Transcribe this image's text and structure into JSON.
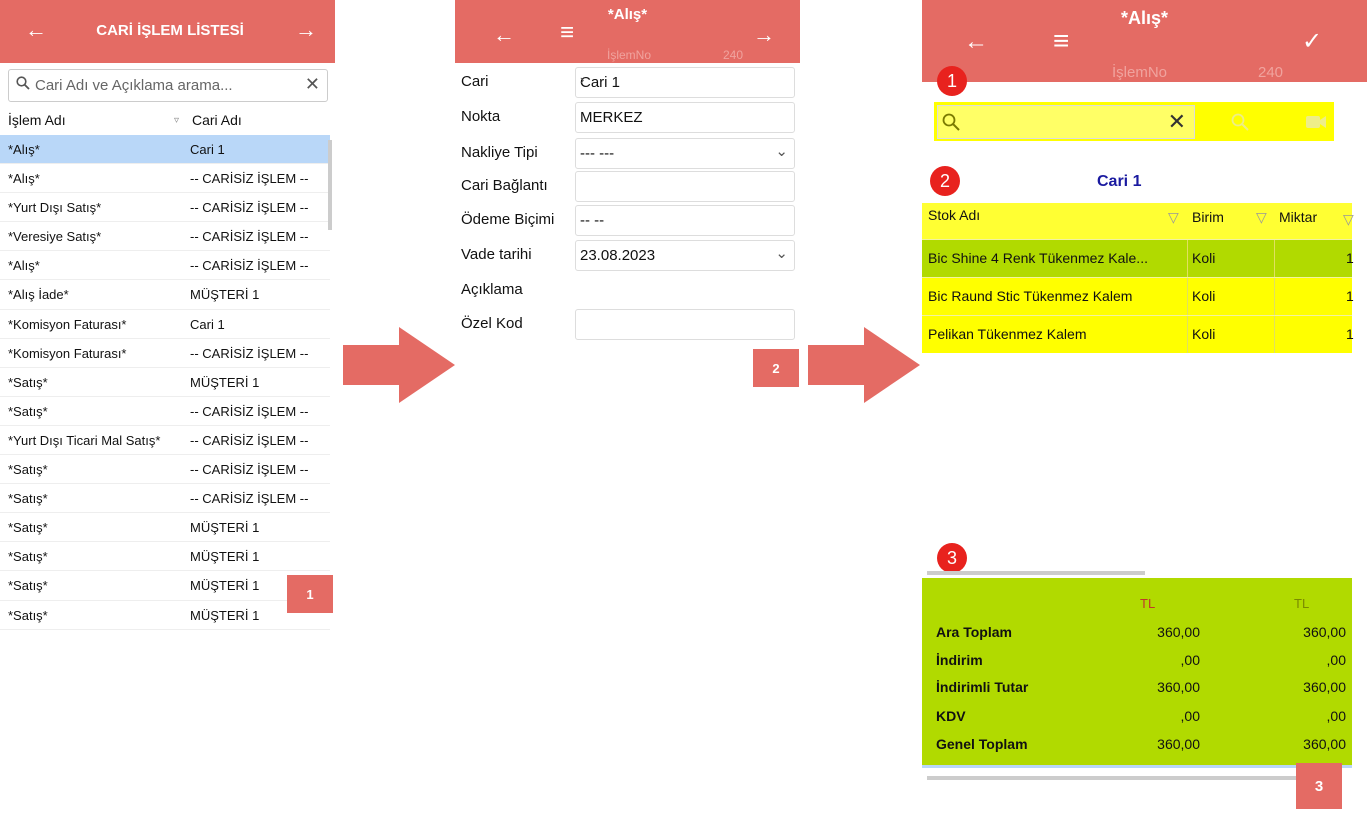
{
  "colors": {
    "header": "#e46b64",
    "selected_row": "#b9d7f8",
    "highlight": "#ffff00",
    "totals_bg": "#b1da00",
    "circle": "#e8221e",
    "title_blue": "#1a1aa0"
  },
  "panel1": {
    "title": "CARİ İŞLEM LİSTESİ",
    "back_icon": "←",
    "forward_icon": "→",
    "search_placeholder": "Cari Adı ve Açıklama arama...",
    "search_icon": "🔍",
    "clear_icon": "✕",
    "columns": [
      "İşlem Adı",
      "Cari Adı"
    ],
    "filter_icon": "▿",
    "rows": [
      {
        "islem": "*Alış*",
        "cari": "Cari 1"
      },
      {
        "islem": "*Alış*",
        "cari": "-- CARİSİZ İŞLEM --"
      },
      {
        "islem": "*Yurt Dışı Satış*",
        "cari": "-- CARİSİZ İŞLEM --"
      },
      {
        "islem": "*Veresiye Satış*",
        "cari": "-- CARİSİZ İŞLEM --"
      },
      {
        "islem": "*Alış*",
        "cari": "-- CARİSİZ İŞLEM --"
      },
      {
        "islem": "*Alış İade*",
        "cari": "MÜŞTERİ 1"
      },
      {
        "islem": "*Komisyon Faturası*",
        "cari": "Cari 1"
      },
      {
        "islem": "*Komisyon Faturası*",
        "cari": "-- CARİSİZ İŞLEM --"
      },
      {
        "islem": "*Satış*",
        "cari": "MÜŞTERİ 1"
      },
      {
        "islem": "*Satış*",
        "cari": "-- CARİSİZ İŞLEM --"
      },
      {
        "islem": "*Yurt Dışı Ticari Mal Satış*",
        "cari": "-- CARİSİZ İŞLEM --"
      },
      {
        "islem": "*Satış*",
        "cari": "-- CARİSİZ İŞLEM --"
      },
      {
        "islem": "*Satış*",
        "cari": "-- CARİSİZ İŞLEM --"
      },
      {
        "islem": "*Satış*",
        "cari": "MÜŞTERİ 1"
      },
      {
        "islem": "*Satış*",
        "cari": "MÜŞTERİ 1"
      },
      {
        "islem": "*Satış*",
        "cari": "MÜŞTERİ 1"
      },
      {
        "islem": "*Satış*",
        "cari": "MÜŞTERİ 1"
      }
    ],
    "step_badge": "1"
  },
  "panel2": {
    "title": "*Alış*",
    "back_icon": "←",
    "menu_icon": "≡",
    "forward_icon": "→",
    "islem_no_label": "İşlemNo",
    "islem_no_value": "240",
    "fields": [
      {
        "label": "Cari",
        "value": "Cari 1",
        "type": "text",
        "suffix": "›"
      },
      {
        "label": "Nokta",
        "value": "MERKEZ",
        "type": "text"
      },
      {
        "label": "Nakliye Tipi",
        "value": "--- ---",
        "type": "select"
      },
      {
        "label": "Cari Bağlantı",
        "value": "",
        "type": "text"
      },
      {
        "label": "Ödeme Biçimi",
        "value": "-- --",
        "type": "text"
      },
      {
        "label": "Vade tarihi",
        "value": "23.08.2023",
        "type": "select"
      },
      {
        "label": "Açıklama",
        "value": "",
        "type": "none"
      },
      {
        "label": "Özel Kod",
        "value": "",
        "type": "text"
      }
    ],
    "chevron_icon": "⌄",
    "step_badge": "2"
  },
  "panel3": {
    "title": "*Alış*",
    "back_icon": "←",
    "menu_icon": "≡",
    "check_icon": "✓",
    "islem_no_label": "İşlemNo",
    "islem_no_value": "240",
    "markers": [
      "1",
      "2",
      "3"
    ],
    "search_icon": "🔍",
    "clear_icon": "✕",
    "camera_icon": "■",
    "cari_title": "Cari 1",
    "columns": [
      "Stok Adı",
      "Birim",
      "Miktar"
    ],
    "filter_icon": "▽",
    "items": [
      {
        "name": "Bic Shine 4 Renk Tükenmez Kale...",
        "unit": "Koli",
        "qty": "1"
      },
      {
        "name": "Bic Raund Stic Tükenmez Kalem",
        "unit": "Koli",
        "qty": "1"
      },
      {
        "name": "Pelikan Tükenmez Kalem",
        "unit": "Koli",
        "qty": "1"
      }
    ],
    "totals_currency": [
      "TL",
      "TL"
    ],
    "totals": [
      {
        "label": "Ara Toplam",
        "v1": "360,00",
        "v2": "360,00"
      },
      {
        "label": "İndirim",
        "v1": ",00",
        "v2": ",00"
      },
      {
        "label": "İndirimli Tutar",
        "v1": "360,00",
        "v2": "360,00"
      },
      {
        "label": "KDV",
        "v1": ",00",
        "v2": ",00"
      },
      {
        "label": "Genel Toplam",
        "v1": "360,00",
        "v2": "360,00"
      }
    ],
    "step_badge": "3"
  }
}
